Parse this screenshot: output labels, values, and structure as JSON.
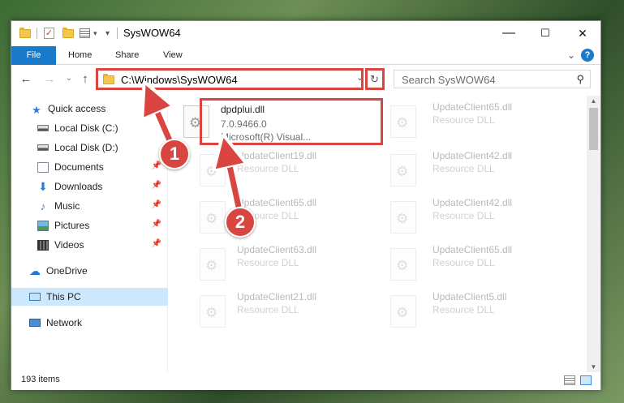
{
  "window": {
    "title": "SysWOW64",
    "minimize_glyph": "—",
    "maximize_glyph": "☐",
    "close_glyph": "✕"
  },
  "quick_access_toolbar": {
    "icons": [
      "folder-icon",
      "checkmark-icon",
      "folder-icon",
      "properties-icon",
      "dropdown-icon"
    ],
    "check_glyph": "✓",
    "dropdown_glyph": "▾"
  },
  "ribbon": {
    "tabs": [
      "File",
      "Home",
      "Share",
      "View"
    ],
    "expand_glyph": "⌄",
    "help_glyph": "?"
  },
  "navigation": {
    "back_glyph": "←",
    "forward_glyph": "→",
    "recent_glyph": "⌄",
    "up_glyph": "↑",
    "address": "C:\\Windows\\SysWOW64",
    "address_dropdown_glyph": "⌄",
    "refresh_glyph": "↻",
    "search_placeholder": "Search SysWOW64",
    "search_glyph": "⚲"
  },
  "sidebar": {
    "pin_glyph": "📌",
    "items": [
      {
        "label": "Quick access",
        "icon": "star-icon",
        "glyph": "★"
      },
      {
        "label": "Local Disk (C:)",
        "icon": "disk-icon"
      },
      {
        "label": "Local Disk (D:)",
        "icon": "disk-icon"
      },
      {
        "label": "Documents",
        "icon": "document-icon",
        "pinned": true
      },
      {
        "label": "Downloads",
        "icon": "download-icon",
        "glyph": "⬇",
        "pinned": true
      },
      {
        "label": "Music",
        "icon": "music-icon",
        "glyph": "♪",
        "pinned": true
      },
      {
        "label": "Pictures",
        "icon": "picture-icon",
        "pinned": true
      },
      {
        "label": "Videos",
        "icon": "video-icon",
        "pinned": true
      },
      {
        "label": "OneDrive",
        "icon": "cloud-icon",
        "glyph": "☁"
      },
      {
        "label": "This PC",
        "icon": "computer-icon",
        "selected": true
      },
      {
        "label": "Network",
        "icon": "network-icon"
      }
    ]
  },
  "files": {
    "highlighted": {
      "name": "dpdplui.dll",
      "version": "7.0.9466.0",
      "description": "Microsoft(R) Visual..."
    },
    "faded": [
      {
        "name": "UpdateClient65.dll",
        "type": "Resource DLL"
      },
      {
        "name": "UpdateClient19.dll",
        "type": "Resource DLL"
      },
      {
        "name": "UpdateClient42.dll",
        "type": "Resource DLL"
      },
      {
        "name": "UpdateClient65.dll",
        "type": "Resource DLL"
      },
      {
        "name": "UpdateClient42.dll",
        "type": "Resource DLL"
      },
      {
        "name": "UpdateClient63.dll",
        "type": "Resource DLL"
      },
      {
        "name": "UpdateClient65.dll",
        "type": "Resource DLL"
      },
      {
        "name": "UpdateClient21.dll",
        "type": "Resource DLL"
      },
      {
        "name": "UpdateClient5.dll",
        "type": "Resource DLL"
      }
    ]
  },
  "scrollbar": {
    "up_glyph": "▲",
    "down_glyph": "▼"
  },
  "status": {
    "item_count": "193 items"
  },
  "annotations": {
    "step1": "1",
    "step2": "2",
    "accent_color": "#d94641"
  }
}
